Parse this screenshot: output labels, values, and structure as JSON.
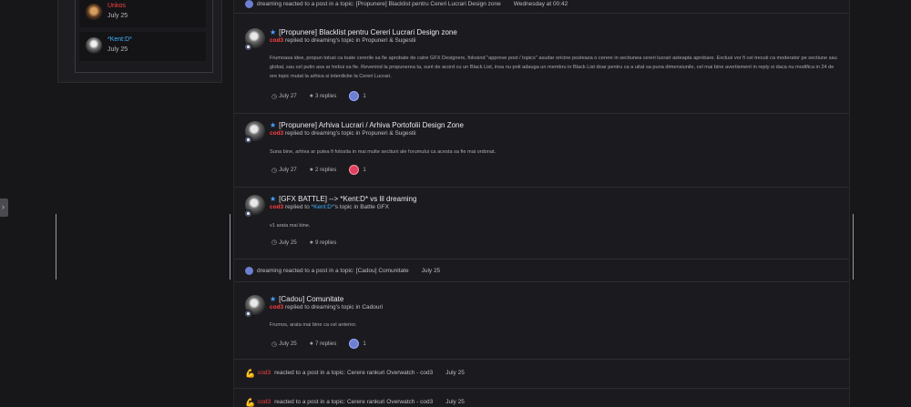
{
  "sidebar": {
    "users": [
      {
        "name": "Unkos",
        "date": "July 25",
        "name_color": "#ff4040"
      },
      {
        "name": "*Kent:D*",
        "date": "July 25",
        "name_color": "#40b0ff"
      }
    ],
    "tab_glyph": "›"
  },
  "stream": {
    "top_reaction": {
      "text": "dreaming reacted to a post in a topic: [Propunere] Blacklist pentru Cereri Lucrari Design zone",
      "date": "Wednesday at 00:42"
    },
    "entries": [
      {
        "title": "[Propunere] Blacklist pentru Cereri Lucrari Design zone",
        "author": "cod3",
        "action": "replied to dreaming's topic in",
        "forum": "Propuneri & Sugestii",
        "body": "Frumoasa idee, propun totusi ca toate cererile sa fie aprobate de catre GFX Designers, folosind \"approve post / topics\" asudar oricine posteaza o cerere in sectiunea cereri lucrari asteapta aprobare. Exclusi vor fi cei trecuti ca moderator pe sectiune sau global, sau cel putin asa ar trebui sa fie. Revenind la propunerea ta, sunt de acord cu un Black List, insa nu poti adauga un membru in Black List doar pentru ca a uitat sa puna dimensiunile, cel mai bine avertisment in reply si daca nu modifica in 24 de ore topic mutat la arhiva si interdictie la Cereri Lucrari.",
        "date": "July 27",
        "replies": "3 replies",
        "reaction_count": "1",
        "reaction": "like"
      },
      {
        "title": "[Propunere] Arhiva Lucrari / Arhiva Portofolii Design Zone",
        "author": "cod3",
        "action": "replied to dreaming's topic in",
        "forum": "Propuneri & Sugestii",
        "body": "Suna bine, arhiva ar putea fi folosita in mai multe sectiuni ale forumului ca acesta sa fie mai ordonat.",
        "date": "July 27",
        "replies": "2 replies",
        "reaction_count": "1",
        "reaction": "love"
      },
      {
        "title": "[GFX BATTLE] --> *Kent:D* vs lil dreaming",
        "author": "cod3",
        "action": "replied to",
        "mention": "*Kent:D*",
        "action2": "'s topic in",
        "forum": "Battle GFX",
        "body": "v1 arata mai bine.",
        "date": "July 25",
        "replies": "9 replies"
      },
      {
        "title": "[Cadou] Comunitate",
        "author": "cod3",
        "action": "replied to dreaming's topic in",
        "forum": "Cadouri",
        "body": "Frumos, arata mai bine ca cel anterior.",
        "date": "July 25",
        "replies": "7 replies",
        "reaction_count": "1",
        "reaction": "like"
      }
    ],
    "mid_reaction": {
      "text": "dreaming reacted to a post in a topic: [Cadou] Comunitate",
      "date": "July 25"
    },
    "bottom_reactions": [
      {
        "user": "cod3",
        "text": "reacted to a post in a topic: Cerere rankuri Overwatch - cod3",
        "date": "July 25"
      },
      {
        "user": "cod3",
        "text": "reacted to a post in a topic: Cerere rankuri Overwatch - cod3",
        "date": "July 25"
      }
    ]
  },
  "icons": {
    "clock": "clock-icon",
    "replies": "comments-icon",
    "star": "star-icon",
    "muscle": "muscle-icon"
  },
  "colors": {
    "accent_blue": "#4aa0ff",
    "author_red": "#ff4040",
    "background": "#17171a",
    "panel": "#1b1b1f"
  }
}
